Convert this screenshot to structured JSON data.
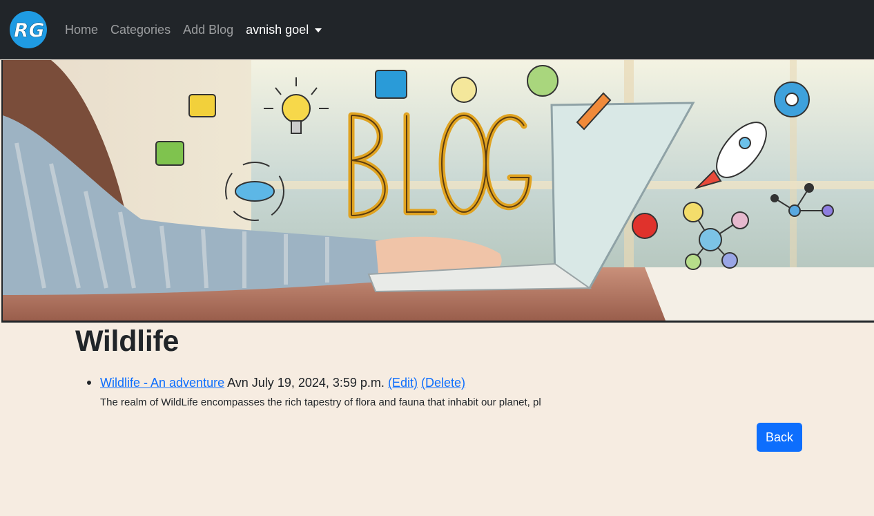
{
  "nav": {
    "logo_text": "RG",
    "links": [
      "Home",
      "Categories",
      "Add Blog"
    ],
    "user": "avnish goel"
  },
  "banner": {
    "word": "BLOG"
  },
  "page": {
    "title": "Wildlife"
  },
  "posts": [
    {
      "title": "Wildlife - An adventure",
      "meta": "Avn July 19, 2024, 3:59 p.m.",
      "edit": "(Edit)",
      "delete": "(Delete)",
      "excerpt": "The realm of WildLife encompasses the rich tapestry of flora and fauna that inhabit our planet, pl"
    }
  ],
  "actions": {
    "back": "Back"
  },
  "colors": {
    "navbar": "#212529",
    "page_bg": "#f6ece1",
    "link": "#0d6efd",
    "button": "#0d6efd",
    "logo": "#1f9be3"
  }
}
